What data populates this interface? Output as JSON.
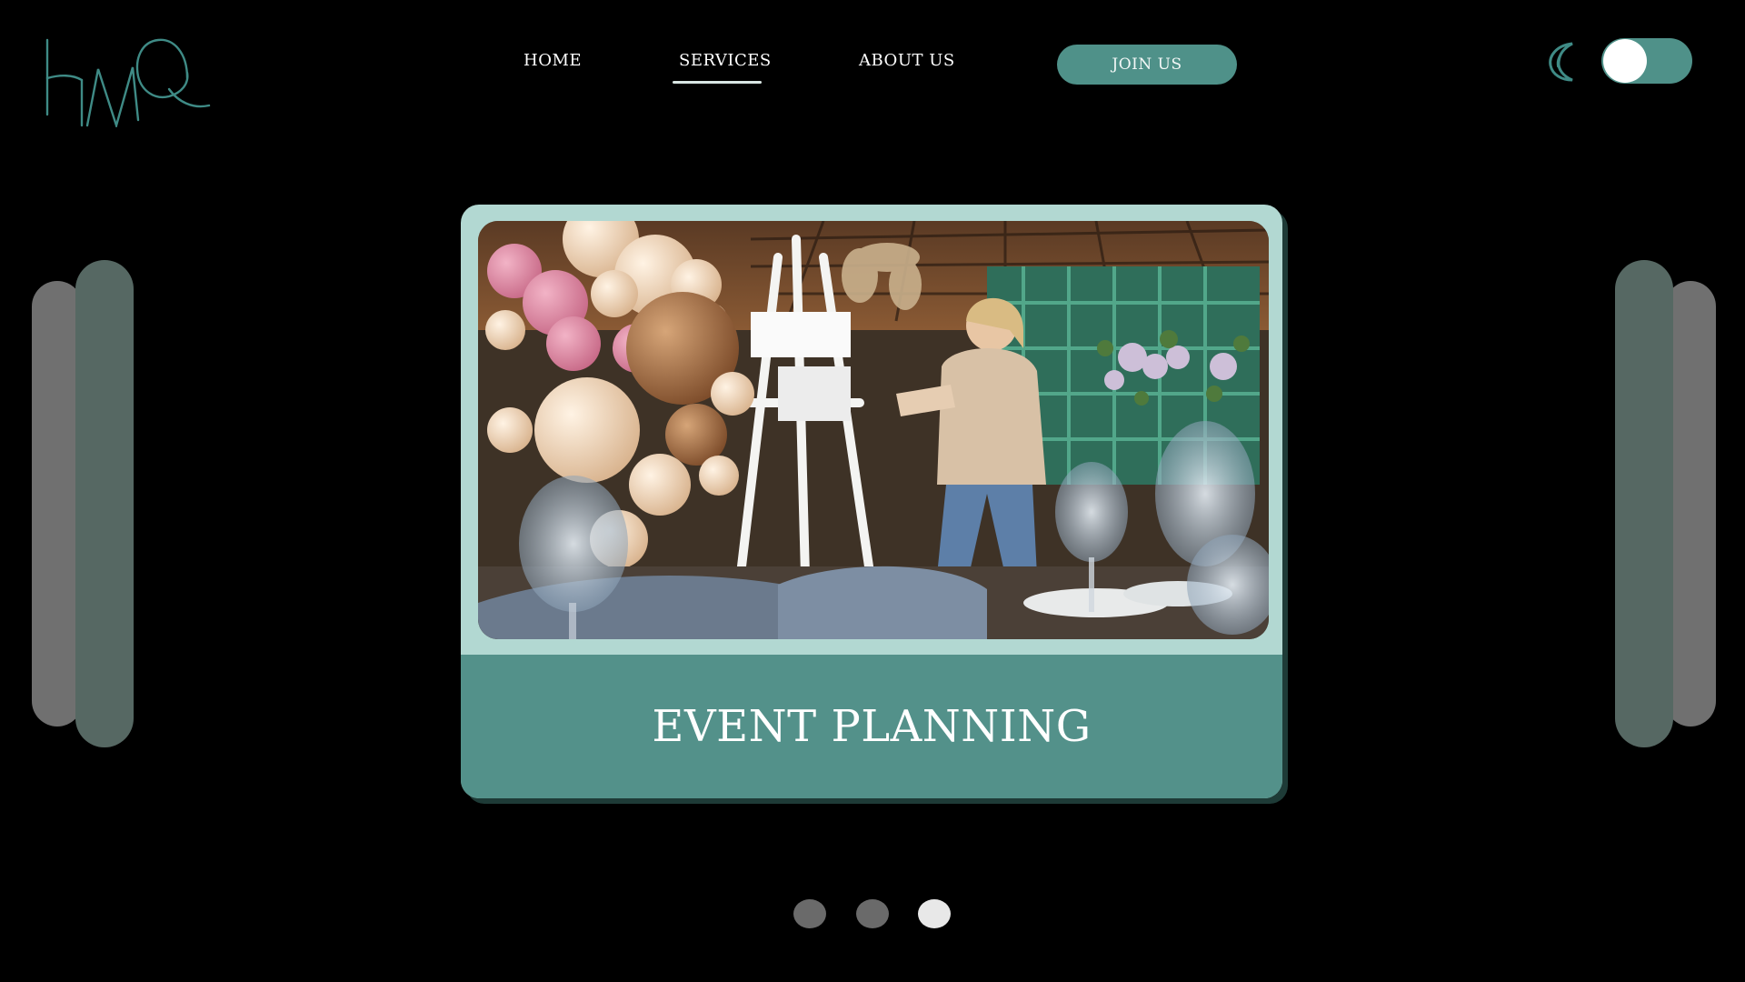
{
  "logo": {
    "text": "HMQ",
    "alt": "HMQ logo"
  },
  "nav": {
    "items": [
      {
        "label": "HOME",
        "active": false
      },
      {
        "label": "SERVICES",
        "active": true
      },
      {
        "label": "ABOUT US",
        "active": false
      }
    ],
    "cta_label": "JOIN US"
  },
  "theme": {
    "mode_icon": "moon-icon",
    "toggle_on": true
  },
  "carousel": {
    "slide_title": "EVENT PLANNING",
    "slide_image": "event-planning-photo",
    "current_slide": 3,
    "total_slides": 3
  },
  "colors": {
    "background": "#000000",
    "accent": "#4f9189",
    "card_light": "#b2d8d2",
    "card_caption": "#53918a",
    "side_bar_front": "#566863",
    "side_bar_back": "#707070",
    "dot_inactive": "#6a6a6a",
    "dot_active": "#e8e8e8"
  }
}
